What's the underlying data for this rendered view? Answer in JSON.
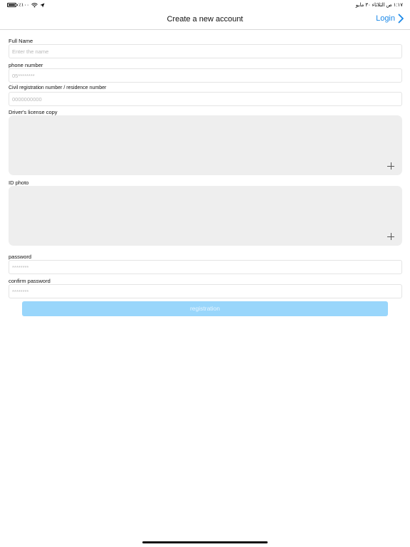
{
  "status_bar": {
    "battery_text": "٪١٠٠",
    "time_date": "١:١٧ ص   الثلاثاء ٣٠ مايو"
  },
  "nav": {
    "title": "Create a new account",
    "login_label": "Login"
  },
  "form": {
    "full_name": {
      "label": "Full Name",
      "placeholder": "Enter the name"
    },
    "phone": {
      "label": "phone number",
      "placeholder": "05********"
    },
    "civil_id": {
      "label": "Civil registration number / residence number",
      "placeholder": "0000000000"
    },
    "license_copy": {
      "label": "Driver's license copy"
    },
    "id_photo": {
      "label": "ID photo"
    },
    "password": {
      "label": "password",
      "placeholder": "********"
    },
    "confirm_password": {
      "label": "confirm password",
      "placeholder": "********"
    },
    "submit_label": "registration"
  },
  "colors": {
    "accent": "#1a88e8",
    "button_disabled": "#99d6fb",
    "upload_bg": "#eeeeee"
  }
}
